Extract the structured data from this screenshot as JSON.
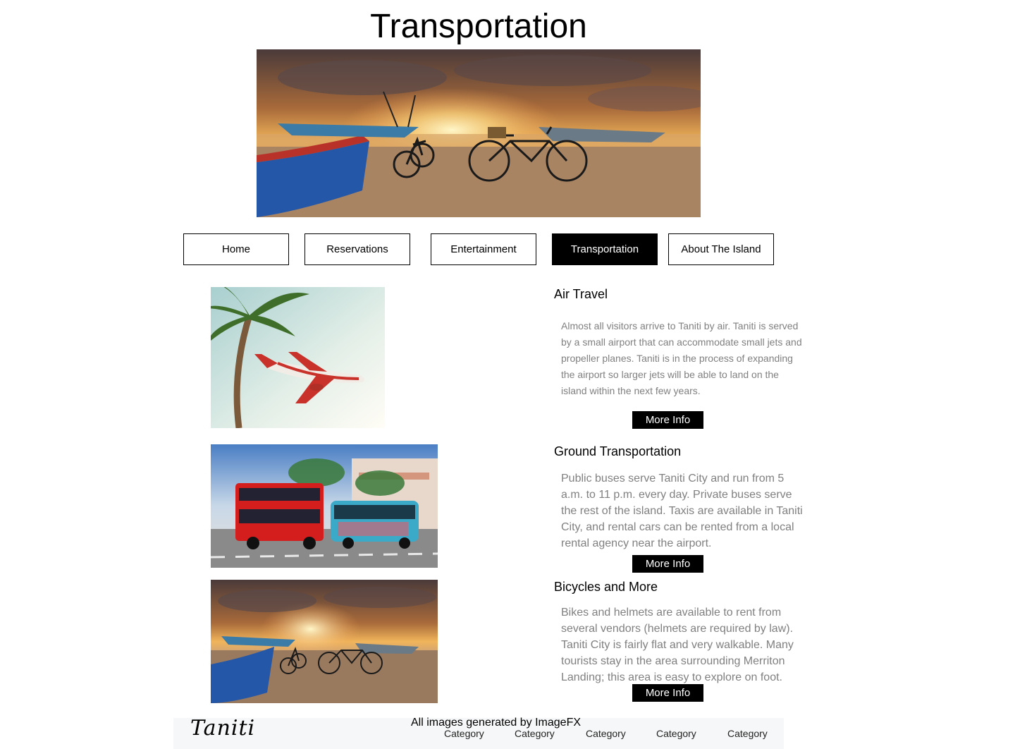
{
  "page": {
    "title": "Transportation"
  },
  "nav": {
    "items": [
      {
        "label": "Home"
      },
      {
        "label": "Reservations"
      },
      {
        "label": "Entertainment"
      },
      {
        "label": "Transportation"
      },
      {
        "label": "About The Island"
      }
    ],
    "active": "Transportation",
    "active_bg": "#000000"
  },
  "sections": [
    {
      "title": "Air Travel",
      "body": "Almost all visitors arrive to Taniti by air. Taniti is served by a small airport that can accommodate small jets and propeller planes. Taniti is in the process of expanding the airport so larger jets will be able to land on the island within the next few years.",
      "button": "More Info"
    },
    {
      "title": "Ground Transportation",
      "body": "Public buses serve Taniti City and run from 5 a.m. to 11 p.m. every day. Private buses serve the rest of the island. Taxis are available in Taniti City, and rental cars can be rented from a local rental agency near the airport.",
      "button": "More Info"
    },
    {
      "title": "Bicycles and More",
      "body": "Bikes and helmets are available to rent from several vendors (helmets are required by law). Taniti City is fairly flat and very walkable. Many tourists stay in the area surrounding Merriton Landing; this area is easy to explore on foot.",
      "button": "More Info"
    }
  ],
  "credit": "All images generated by ImageFX",
  "footer": {
    "logo": "Taniti",
    "categories": [
      "Category",
      "Category",
      "Category",
      "Category",
      "Category"
    ]
  }
}
